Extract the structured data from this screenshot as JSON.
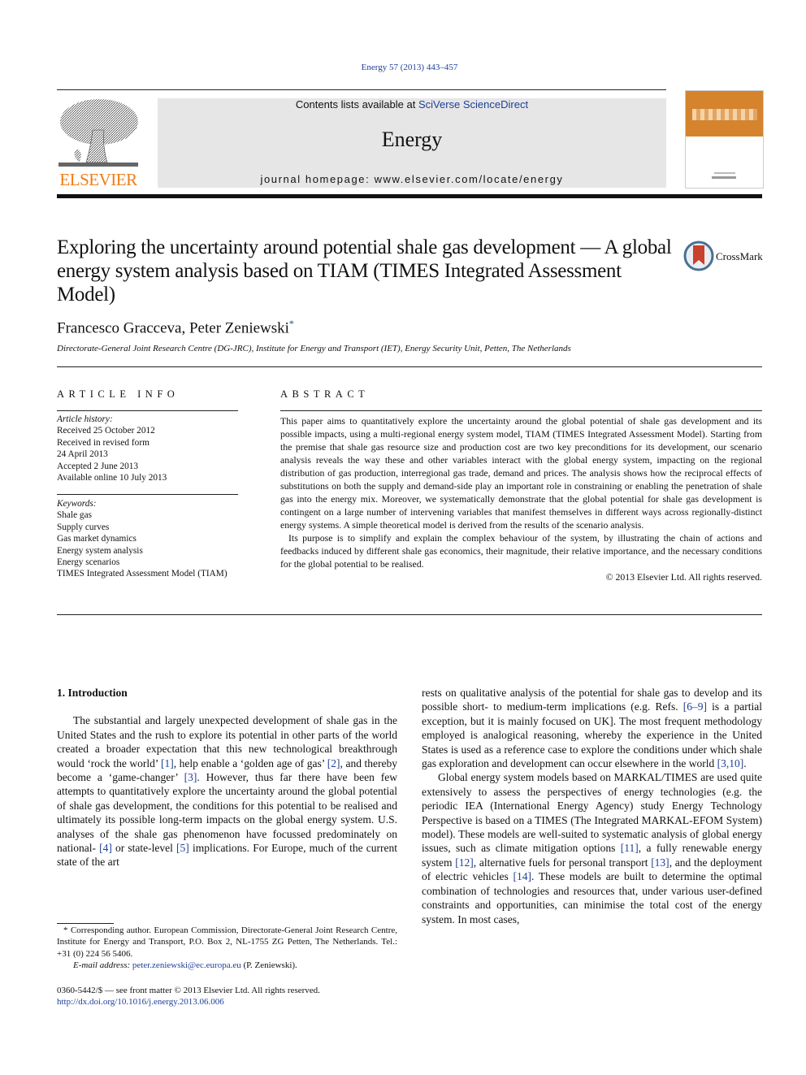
{
  "header": {
    "citation": "Energy 57 (2013) 443–457",
    "contents_prefix": "Contents lists available at ",
    "contents_link": "SciVerse ScienceDirect",
    "journal_name": "Energy",
    "homepage_prefix": "journal homepage: ",
    "homepage_url": "www.elsevier.com/locate/energy",
    "publisher_logo": "ELSEVIER",
    "cover_image": "energy-journal-cover",
    "colors": {
      "publisher_orange": "#f07c15",
      "link_blue": "#1f3f97",
      "header_gray": "#e6e6e6",
      "cover_orange": "#d5832c"
    }
  },
  "article": {
    "title": "Exploring the uncertainty around potential shale gas development — A global energy system analysis based on TIAM (TIMES Integrated Assessment Model)",
    "crossmark_label": "CrossMark",
    "authors": "Francesco Gracceva, Peter Zeniewski",
    "author_mark": "*",
    "affiliation": "Directorate-General Joint Research Centre (DG-JRC), Institute for Energy and Transport (IET), Energy Security Unit, Petten, The Netherlands"
  },
  "article_info": {
    "heading": "ARTICLE INFO",
    "history_label": "Article history:",
    "history": [
      "Received 25 October 2012",
      "Received in revised form",
      "24 April 2013",
      "Accepted 2 June 2013",
      "Available online 10 July 2013"
    ],
    "keywords_label": "Keywords:",
    "keywords": [
      "Shale gas",
      "Supply curves",
      "Gas market dynamics",
      "Energy system analysis",
      "Energy scenarios",
      "TIMES Integrated Assessment Model (TIAM)"
    ]
  },
  "abstract": {
    "heading": "ABSTRACT",
    "paragraphs": [
      "This paper aims to quantitatively explore the uncertainty around the global potential of shale gas development and its possible impacts, using a multi-regional energy system model, TIAM (TIMES Integrated Assessment Model). Starting from the premise that shale gas resource size and production cost are two key preconditions for its development, our scenario analysis reveals the way these and other variables interact with the global energy system, impacting on the regional distribution of gas production, interregional gas trade, demand and prices. The analysis shows how the reciprocal effects of substitutions on both the supply and demand-side play an important role in constraining or enabling the penetration of shale gas into the energy mix. Moreover, we systematically demonstrate that the global potential for shale gas development is contingent on a large number of intervening variables that manifest themselves in different ways across regionally-distinct energy systems. A simple theoretical model is derived from the results of the scenario analysis.",
      "Its purpose is to simplify and explain the complex behaviour of the system, by illustrating the chain of actions and feedbacks induced by different shale gas economics, their magnitude, their relative importance, and the necessary conditions for the global potential to be realised."
    ],
    "copyright": "© 2013 Elsevier Ltd. All rights reserved."
  },
  "body": {
    "section_heading": "1.  Introduction",
    "left_p1": [
      {
        "t": "The substantial and largely unexpected development of shale gas in the United States and the rush to explore its potential in other parts of the world created a broader expectation that this new technological breakthrough would ‘rock the world’ "
      },
      {
        "ref": "[1]"
      },
      {
        "t": ", help enable a ‘golden age of gas’ "
      },
      {
        "ref": "[2]"
      },
      {
        "t": ", and thereby become a ‘game-changer’ "
      },
      {
        "ref": "[3]"
      },
      {
        "t": ". However, thus far there have been few attempts to quantitatively explore the uncertainty around the global potential of shale gas development, the conditions for this potential to be realised and ultimately its possible long-term impacts on the global energy system. U.S. analyses of the shale gas phenomenon have focussed predominately on national- "
      },
      {
        "ref": "[4]"
      },
      {
        "t": " or state-level "
      },
      {
        "ref": "[5]"
      },
      {
        "t": " implications. For Europe, much of the current state of the art"
      }
    ],
    "right_p1": [
      {
        "t": "rests on qualitative analysis of the potential for shale gas to develop and its possible short- to medium-term implications (e.g. Refs. "
      },
      {
        "ref": "[6–9]"
      },
      {
        "t": " is a partial exception, but it is mainly focused on UK]. The most frequent methodology employed is analogical reasoning, whereby the experience in the United States is used as a reference case to explore the conditions under which shale gas exploration and development can occur elsewhere in the world "
      },
      {
        "ref": "[3,10]"
      },
      {
        "t": "."
      }
    ],
    "right_p2": [
      {
        "t": "Global energy system models based on MARKAL/TIMES are used quite extensively to assess the perspectives of energy technologies (e.g. the periodic IEA (International Energy Agency) study Energy Technology Perspective is based on a TIMES (The Integrated MARKAL-EFOM System) model). These models are well-suited to systematic analysis of global energy issues, such as climate mitigation options "
      },
      {
        "ref": "[11]"
      },
      {
        "t": ", a fully renewable energy system "
      },
      {
        "ref": "[12]"
      },
      {
        "t": ", alternative fuels for personal transport "
      },
      {
        "ref": "[13]"
      },
      {
        "t": ", and the deployment of electric vehicles "
      },
      {
        "ref": "[14]"
      },
      {
        "t": ". These models are built to determine the optimal combination of technologies and resources that, under various user-defined constraints and opportunities, can minimise the total cost of the energy system. In most cases,"
      }
    ]
  },
  "footnote": {
    "corresponding": "* Corresponding author. European Commission, Directorate-General Joint Research Centre, Institute for Energy and Transport, P.O. Box 2, NL-1755 ZG Petten, The Netherlands. Tel.: +31 (0) 224 56 5406.",
    "email_label": "E-mail address: ",
    "email": "peter.zeniewski@ec.europa.eu",
    "email_suffix": " (P. Zeniewski).",
    "issn_line": "0360-5442/$ — see front matter © 2013 Elsevier Ltd. All rights reserved.",
    "doi": "http://dx.doi.org/10.1016/j.energy.2013.06.006"
  }
}
